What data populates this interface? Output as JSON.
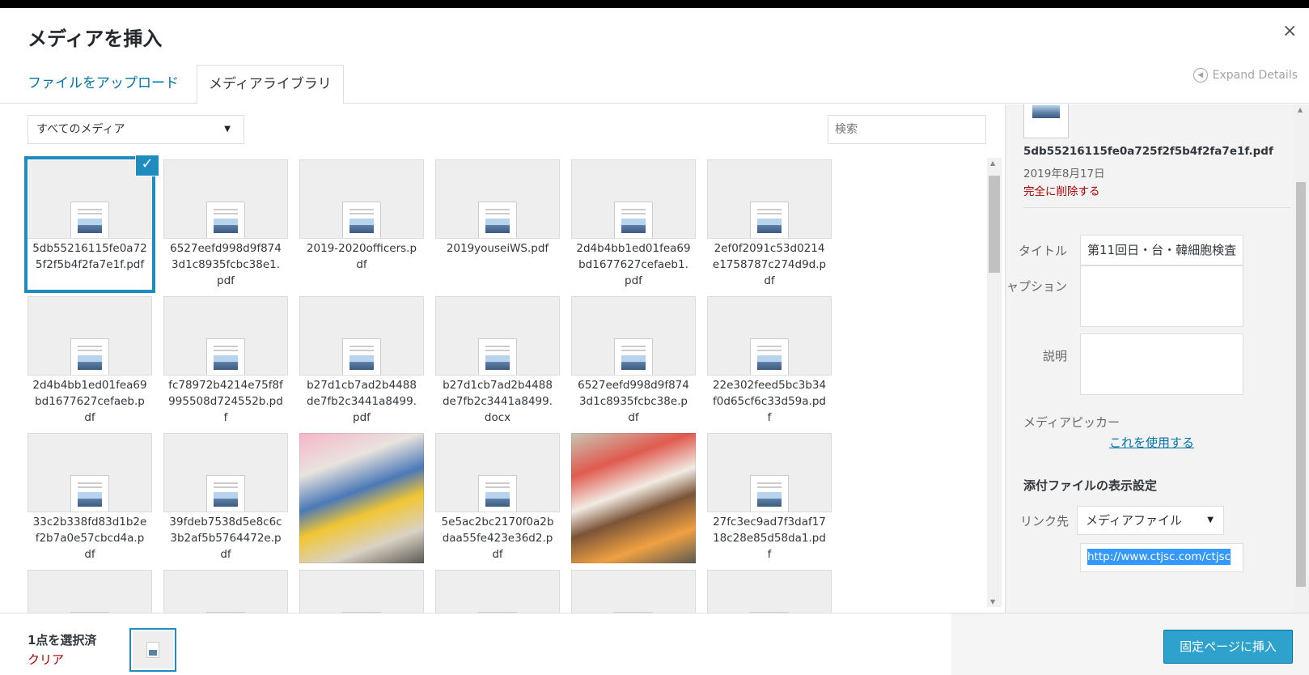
{
  "header": {
    "title": "メディアを挿入",
    "close_glyph": "×"
  },
  "tabs": {
    "upload": "ファイルをアップロード",
    "library": "メディアライブラリ"
  },
  "expand_details": "Expand Details",
  "filter": {
    "selected": "すべてのメディア"
  },
  "search": {
    "placeholder": "検索"
  },
  "tiles": [
    {
      "type": "doc",
      "name": "5db55216115fe0a725f2f5b4f2fa7e1f.pdf",
      "selected": true
    },
    {
      "type": "doc",
      "name": "6527eefd998d9f8743d1c8935fcbc38e1.pdf"
    },
    {
      "type": "doc",
      "name": "2019-2020officers.pdf"
    },
    {
      "type": "doc",
      "name": "2019youseiWS.pdf"
    },
    {
      "type": "doc",
      "name": "2d4b4bb1ed01fea69bd1677627cefaeb1.pdf"
    },
    {
      "type": "doc",
      "name": "2ef0f2091c53d0214e1758787c274d9d.pdf"
    },
    {
      "type": "doc",
      "name": "2d4b4bb1ed01fea69bd1677627cefaeb.pdf"
    },
    {
      "type": "doc",
      "name": "fc78972b4214e75f8f995508d724552b.pdf"
    },
    {
      "type": "doc",
      "name": "b27d1cb7ad2b4488de7fb2c3441a8499.pdf"
    },
    {
      "type": "doc",
      "name": "b27d1cb7ad2b4488de7fb2c3441a8499.docx"
    },
    {
      "type": "doc",
      "name": "6527eefd998d9f8743d1c8935fcbc38e.pdf"
    },
    {
      "type": "doc",
      "name": "22e302feed5bc3b34f0d65cf6c33d59a.pdf"
    },
    {
      "type": "doc",
      "name": "33c2b338fd83d1b2ef2b7a0e57cbcd4a.pdf"
    },
    {
      "type": "doc",
      "name": "39fdeb7538d5e8c6c3b2af5b5764472e.pdf"
    },
    {
      "type": "photo",
      "variant": 1
    },
    {
      "type": "doc",
      "name": "5e5ac2bc2170f0a2bdaa55fe423e36d2.pdf"
    },
    {
      "type": "photo",
      "variant": 2
    },
    {
      "type": "doc",
      "name": "27fc3ec9ad7f3daf1718c28e85d58da1.pdf"
    },
    {
      "type": "doc",
      "name": ""
    },
    {
      "type": "doc",
      "name": ""
    },
    {
      "type": "doc",
      "name": ""
    },
    {
      "type": "doc",
      "name": ""
    },
    {
      "type": "doc",
      "name": ""
    },
    {
      "type": "doc",
      "name": ""
    }
  ],
  "details": {
    "filename": "5db55216115fe0a725f2f5b4f2fa7e1f.pdf",
    "date": "2019年8月17日",
    "delete_label": "完全に削除する",
    "title_label": "タイトル",
    "title_value": "第11回日・台・韓細胞検査",
    "caption_label": "キャプション",
    "description_label": "説明",
    "media_picker_label": "メディアピッカー",
    "media_picker_link": "これを使用する",
    "attachment_heading": "添付ファイルの表示設定",
    "link_label": "リンク先",
    "link_value": "メディアファイル",
    "url_value": "http://www.ctjsc.com/ctjsc"
  },
  "footer": {
    "selected_count": "1点を選択済",
    "clear_label": "クリア",
    "insert_label": "固定ページに挿入"
  },
  "colors": {
    "accent": "#1e8cbe",
    "link": "#0073aa",
    "danger": "#a00000",
    "primary_button": "#2ea2cc"
  }
}
